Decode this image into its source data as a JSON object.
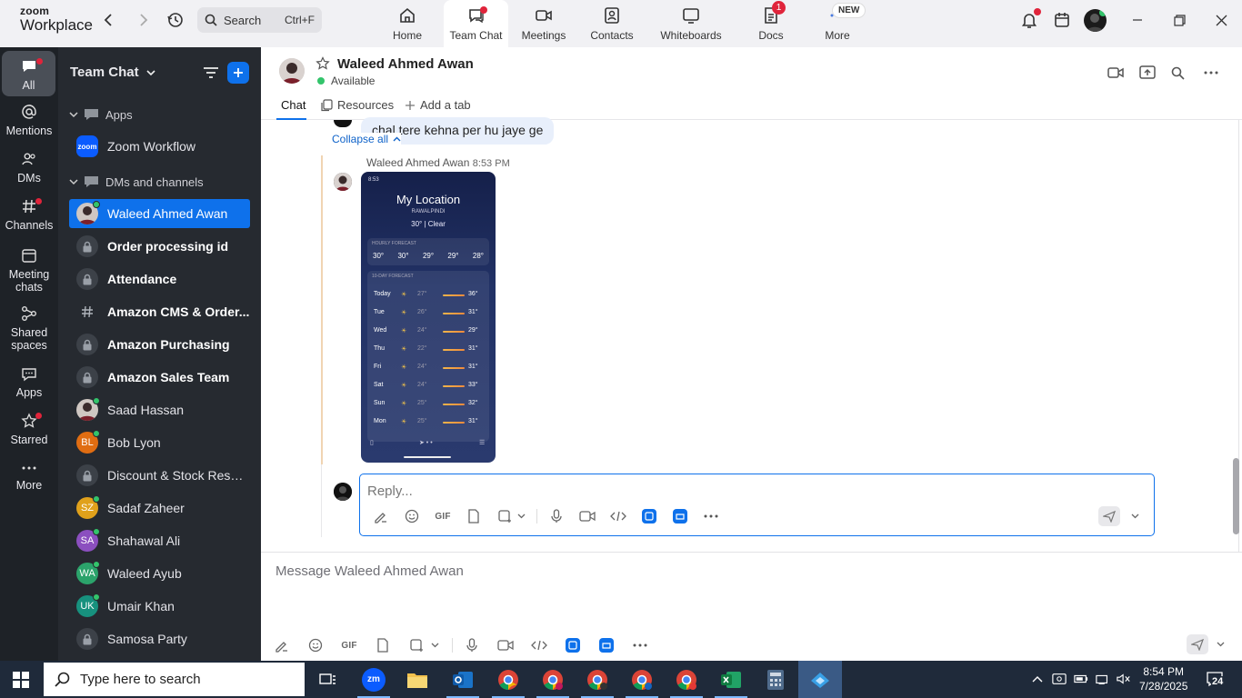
{
  "app": {
    "logo_line1": "zoom",
    "logo_line2": "Workplace"
  },
  "topbar": {
    "search_placeholder": "Search",
    "search_shortcut": "Ctrl+F",
    "tabs": [
      {
        "label": "Home",
        "icon": "home-icon"
      },
      {
        "label": "Team Chat",
        "icon": "chat-icon",
        "active": true
      },
      {
        "label": "Meetings",
        "icon": "video-icon"
      },
      {
        "label": "Contacts",
        "icon": "contacts-icon"
      },
      {
        "label": "Whiteboards",
        "icon": "whiteboard-icon"
      },
      {
        "label": "Docs",
        "icon": "docs-icon",
        "badge": "1"
      },
      {
        "label": "More",
        "icon": "more-icon",
        "badge_text": "NEW"
      }
    ]
  },
  "rail": {
    "items": [
      {
        "label": "All",
        "icon": "chat-bubble-icon"
      },
      {
        "label": "Mentions",
        "icon": "at-icon"
      },
      {
        "label": "DMs",
        "icon": "people-icon"
      },
      {
        "label": "Channels",
        "icon": "hash-icon"
      },
      {
        "label": "Meeting chats",
        "icon": "calendar-icon"
      },
      {
        "label": "Shared spaces",
        "icon": "share-icon"
      },
      {
        "label": "Apps",
        "icon": "apps-icon"
      },
      {
        "label": "Starred",
        "icon": "star-icon"
      },
      {
        "label": "More",
        "icon": "ellipsis-icon"
      }
    ]
  },
  "sidebar": {
    "title": "Team Chat",
    "sections": {
      "apps": "Apps",
      "dms": "DMs and channels"
    },
    "apps": [
      {
        "label": "Zoom Workflow",
        "icon_text": "zoom"
      }
    ],
    "items": [
      {
        "label": "Waleed Ahmed Awan",
        "type": "avatar",
        "active": true
      },
      {
        "label": "Order processing id",
        "type": "lock",
        "bold": true
      },
      {
        "label": "Attendance",
        "type": "lock",
        "bold": true
      },
      {
        "label": "Amazon CMS & Order...",
        "type": "hash",
        "bold": true
      },
      {
        "label": "Amazon Purchasing",
        "type": "lock",
        "bold": true
      },
      {
        "label": "Amazon Sales Team",
        "type": "lock",
        "bold": true
      },
      {
        "label": "Saad Hassan",
        "type": "avatar"
      },
      {
        "label": "Bob Lyon",
        "type": "initials",
        "initials": "BL",
        "color": "#e06d12"
      },
      {
        "label": "Discount & Stock Reser...",
        "type": "lock"
      },
      {
        "label": "Sadaf Zaheer",
        "type": "initials",
        "initials": "SZ",
        "color": "#e0a11b"
      },
      {
        "label": "Shahawal Ali",
        "type": "initials",
        "initials": "SA",
        "color": "#8b4fbf"
      },
      {
        "label": "Waleed Ayub",
        "type": "initials",
        "initials": "WA",
        "color": "#2ba36b"
      },
      {
        "label": "Umair Khan",
        "type": "initials",
        "initials": "UK",
        "color": "#17917e"
      },
      {
        "label": "Samosa Party",
        "type": "lock"
      }
    ]
  },
  "chat": {
    "contact_name": "Waleed Ahmed Awan",
    "status": "Available",
    "tabs": {
      "chat": "Chat",
      "resources": "Resources",
      "add": "Add a tab"
    },
    "previous_message": "chal tere kehna per hu jaye ge",
    "collapse_label": "Collapse all",
    "message_sender": "Waleed Ahmed Awan",
    "message_time": "8:53 PM",
    "reply_placeholder": "Reply...",
    "compose_placeholder": "Message Waleed Ahmed Awan",
    "gif_label": "GIF"
  },
  "weather_image": {
    "status_time": "8:53",
    "location": "My Location",
    "sublocation": "RAWALPINDI",
    "condition": "30° | Clear",
    "hourly_label": "HOURLY FORECAST",
    "hourly": [
      "30°",
      "30°",
      "29°",
      "29°",
      "28°"
    ],
    "daily_label": "10-DAY FORECAST",
    "daily": [
      {
        "day": "Today",
        "low": "27°",
        "high": "36°"
      },
      {
        "day": "Tue",
        "low": "26°",
        "high": "31°"
      },
      {
        "day": "Wed",
        "low": "24°",
        "high": "29°"
      },
      {
        "day": "Thu",
        "low": "22°",
        "high": "31°"
      },
      {
        "day": "Fri",
        "low": "24°",
        "high": "31°"
      },
      {
        "day": "Sat",
        "low": "24°",
        "high": "33°"
      },
      {
        "day": "Sun",
        "low": "25°",
        "high": "32°"
      },
      {
        "day": "Mon",
        "low": "25°",
        "high": "31°"
      }
    ]
  },
  "taskbar": {
    "search_placeholder": "Type here to search",
    "time": "8:54 PM",
    "date": "7/28/2025",
    "notification_count": "24"
  },
  "colors": {
    "accent": "#0e71eb",
    "sidebar_bg": "#262a30",
    "rail_bg": "#1e2227",
    "online": "#33c46b",
    "alert": "#e0243b"
  }
}
